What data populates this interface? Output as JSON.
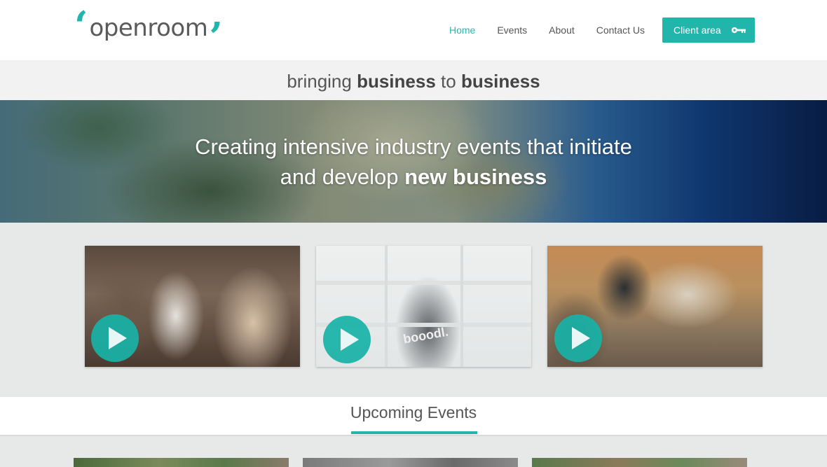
{
  "header": {
    "logo": {
      "text_light": "open",
      "text_bold": "room",
      "quote_open": "‘",
      "quote_close": "’",
      "accent": "#22b5ab"
    },
    "nav": [
      {
        "label": "Home",
        "active": true
      },
      {
        "label": "Events",
        "active": false
      },
      {
        "label": "About",
        "active": false
      },
      {
        "label": "Contact Us",
        "active": false
      }
    ],
    "client_area": {
      "label": "Client area",
      "icon": "key-icon"
    }
  },
  "tagline": {
    "part1": "bringing ",
    "bold1": "business",
    "part2": " to ",
    "bold2": "business"
  },
  "hero": {
    "line1": "Creating intensive industry events that initiate",
    "line2_plain": "and develop ",
    "line2_bold": "new business"
  },
  "videos": [
    {
      "name": "networking-video",
      "icon": "play-icon"
    },
    {
      "name": "presenter-video",
      "icon": "play-icon",
      "shirt_text": "booodl."
    },
    {
      "name": "meeting-video",
      "icon": "play-icon"
    }
  ],
  "upcoming": {
    "title": "Upcoming Events"
  },
  "colors": {
    "accent": "#22b5ab",
    "active_nav": "#2ab7ad",
    "text": "#555555"
  }
}
